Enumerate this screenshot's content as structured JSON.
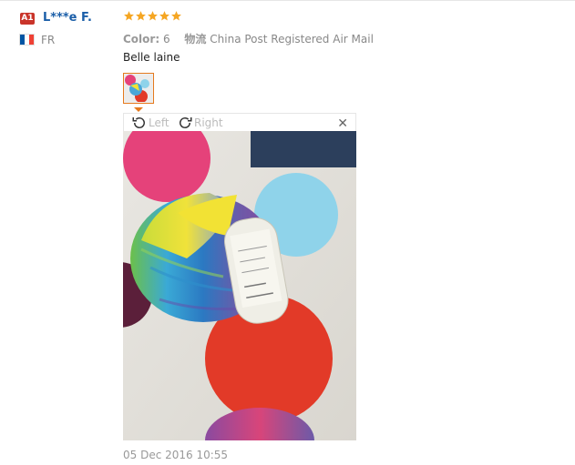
{
  "review": {
    "badge": "A1",
    "username": "L***e F.",
    "country_code": "FR",
    "flag_colors": [
      "#0055a4",
      "#ffffff",
      "#ef4135"
    ],
    "rating": 5,
    "rating_color": "#f5a623",
    "color_label": "Color:",
    "color_value": "6",
    "shipping_label": "物流",
    "shipping_value": "China Post Registered Air Mail",
    "comment": "Belle laine",
    "date": "05 Dec 2016 10:55"
  },
  "viewer": {
    "rotate_left_label": "Left",
    "rotate_right_label": "Right",
    "close_icon": "close-icon",
    "rotate_left_icon": "rotate-left-icon",
    "rotate_right_icon": "rotate-right-icon"
  }
}
